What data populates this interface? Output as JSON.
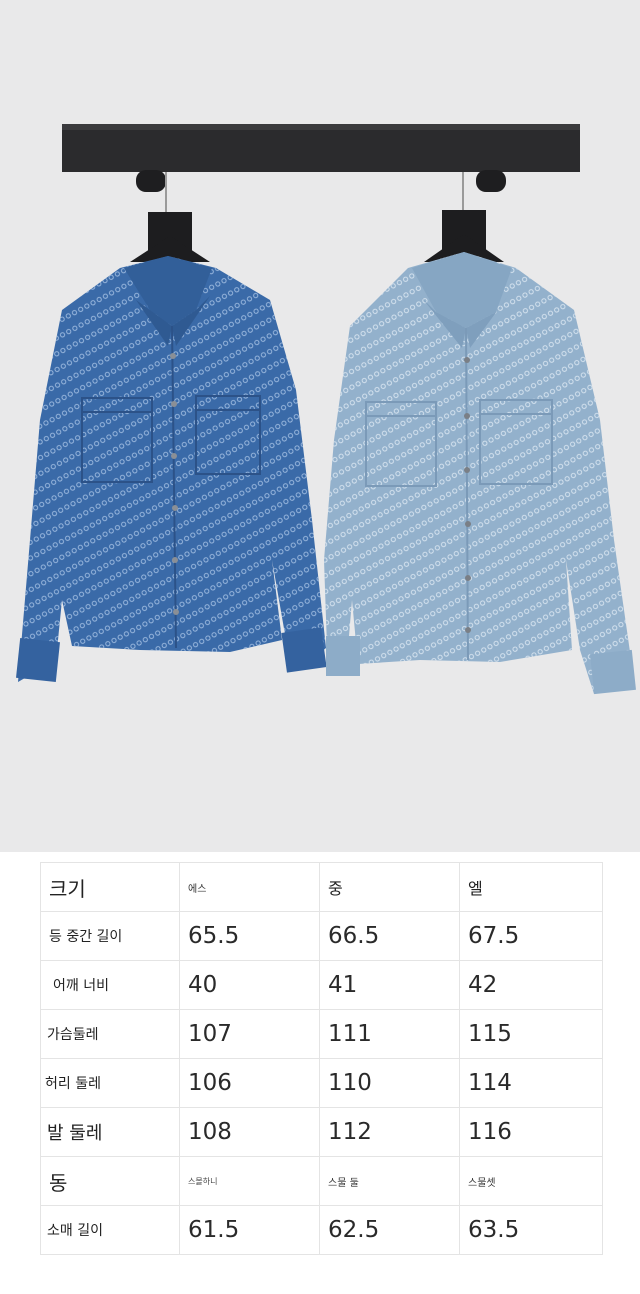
{
  "size_table": {
    "header": {
      "label": "크기",
      "s": "에스",
      "m": "중",
      "l": "엘"
    },
    "rows": [
      {
        "label": "등 중간 길이",
        "s": "65.5",
        "m": "66.5",
        "l": "67.5"
      },
      {
        "label": "어깨 너비",
        "s": "40",
        "m": "41",
        "l": "42"
      },
      {
        "label": "가슴둘레",
        "s": "107",
        "m": "111",
        "l": "115"
      },
      {
        "label": "허리 둘레",
        "s": "106",
        "m": "110",
        "l": "114"
      },
      {
        "label": "발 둘레",
        "s": "108",
        "m": "112",
        "l": "116"
      },
      {
        "label": "동",
        "s": "스몰하니",
        "m": "스물 둘",
        "l": "스물셋"
      },
      {
        "label": "소매 길이",
        "s": "61.5",
        "m": "62.5",
        "l": "63.5"
      }
    ]
  },
  "colors": {
    "background": "#e8e8e9",
    "rack": "#2b2b2d",
    "dark_denim": "#3a6aa8",
    "light_denim": "#93b1cc"
  }
}
